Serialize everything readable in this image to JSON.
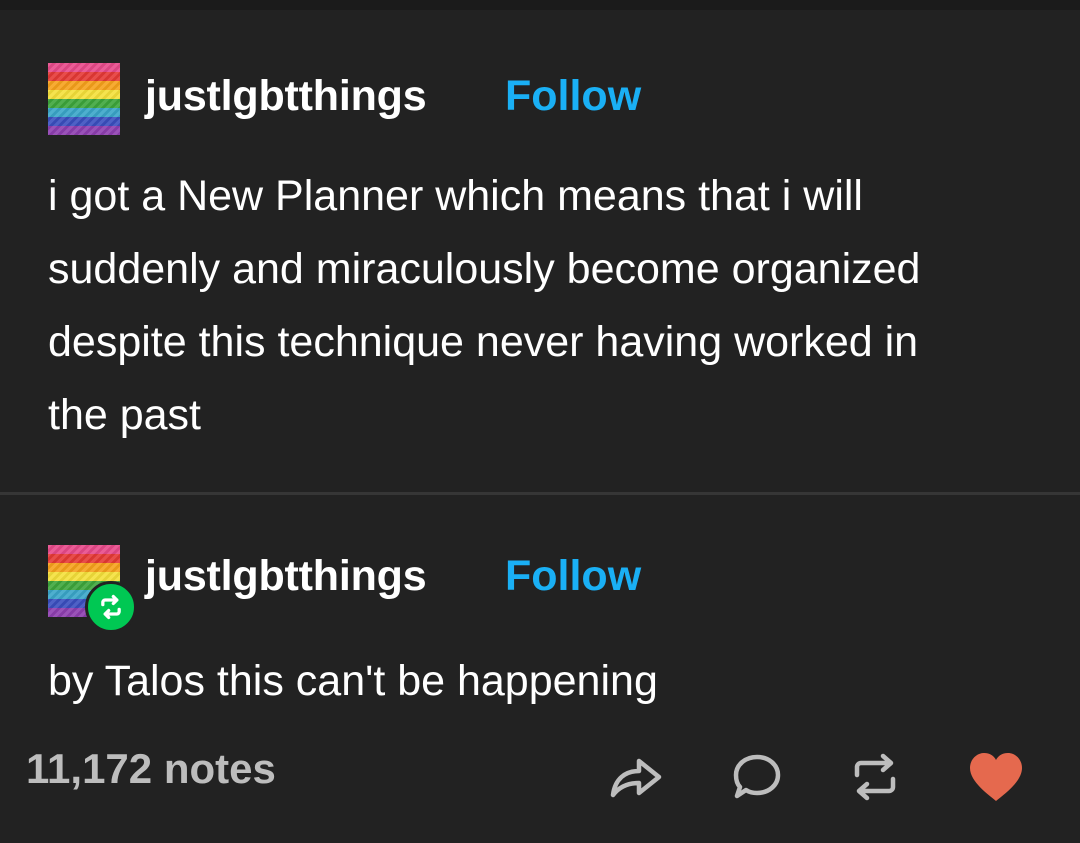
{
  "posts": [
    {
      "username": "justlgbtthings",
      "follow_label": "Follow",
      "text": "i got a New Planner which means that i will suddenly and miraculously become organized despite this technique never having worked in the past"
    },
    {
      "username": "justlgbtthings",
      "follow_label": "Follow",
      "text": "by Talos this can't be happening"
    }
  ],
  "footer": {
    "notes": "11,172 notes",
    "icons": [
      "share-icon",
      "reply-icon",
      "reblog-icon",
      "like-icon"
    ]
  },
  "colors": {
    "background": "#222222",
    "follow": "#1ab0f5",
    "like": "#e5694e",
    "reblog_badge": "#00c853",
    "notes": "#bdbdbd"
  }
}
